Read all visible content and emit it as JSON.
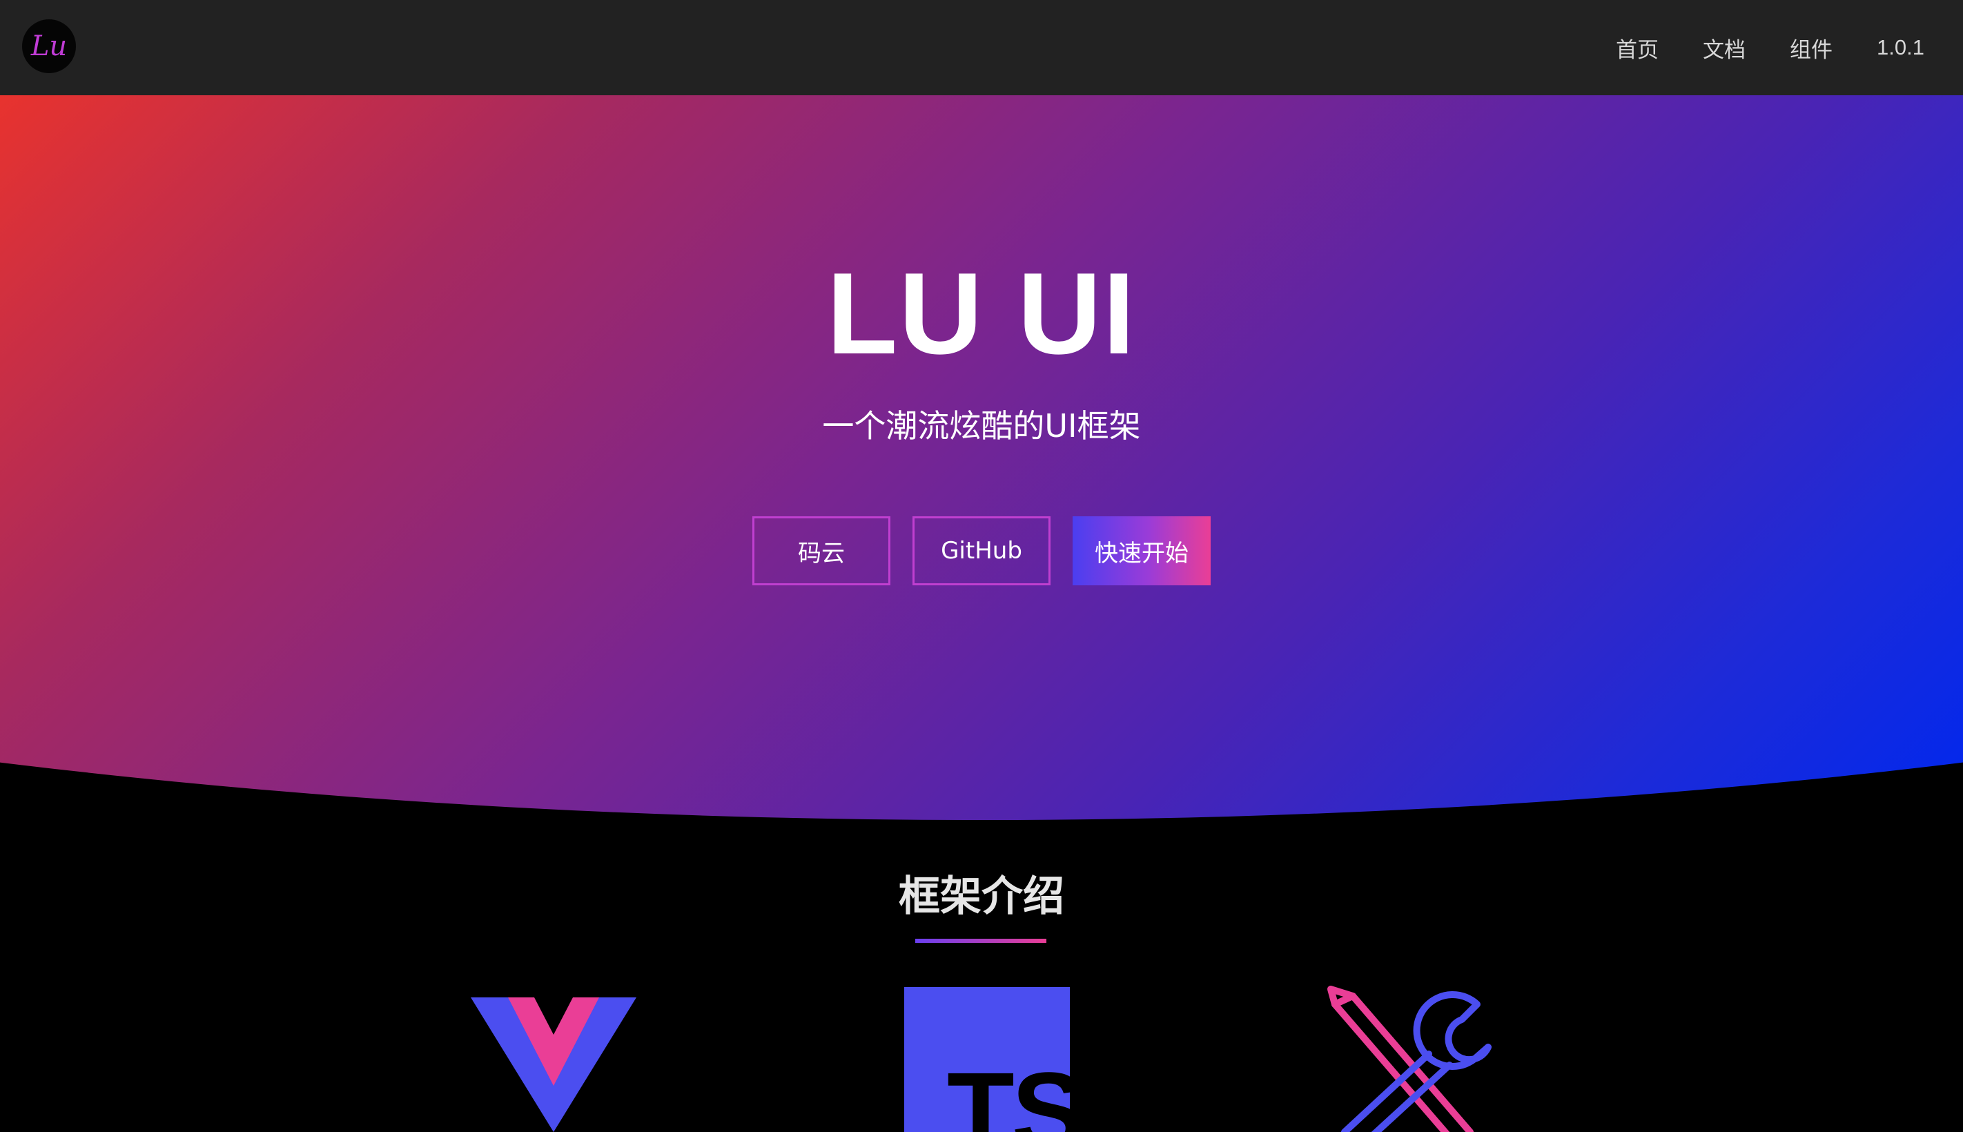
{
  "header": {
    "logo_text": "Lu",
    "nav": [
      "首页",
      "文档",
      "组件",
      "1.0.1"
    ]
  },
  "hero": {
    "title": "LU UI",
    "subtitle": "一个潮流炫酷的UI框架",
    "buttons": [
      "码云",
      "GitHub",
      "快速开始"
    ]
  },
  "intro": {
    "title": "框架介绍",
    "icons": [
      "vue-icon",
      "typescript-icon",
      "tools-icon"
    ],
    "ts_label": "TS"
  },
  "colors": {
    "topbar": "#222222",
    "gradient_start": "#e8332e",
    "gradient_end": "#0028ee",
    "accent_pink": "#ea3e96",
    "accent_blue": "#4b4ef0"
  }
}
